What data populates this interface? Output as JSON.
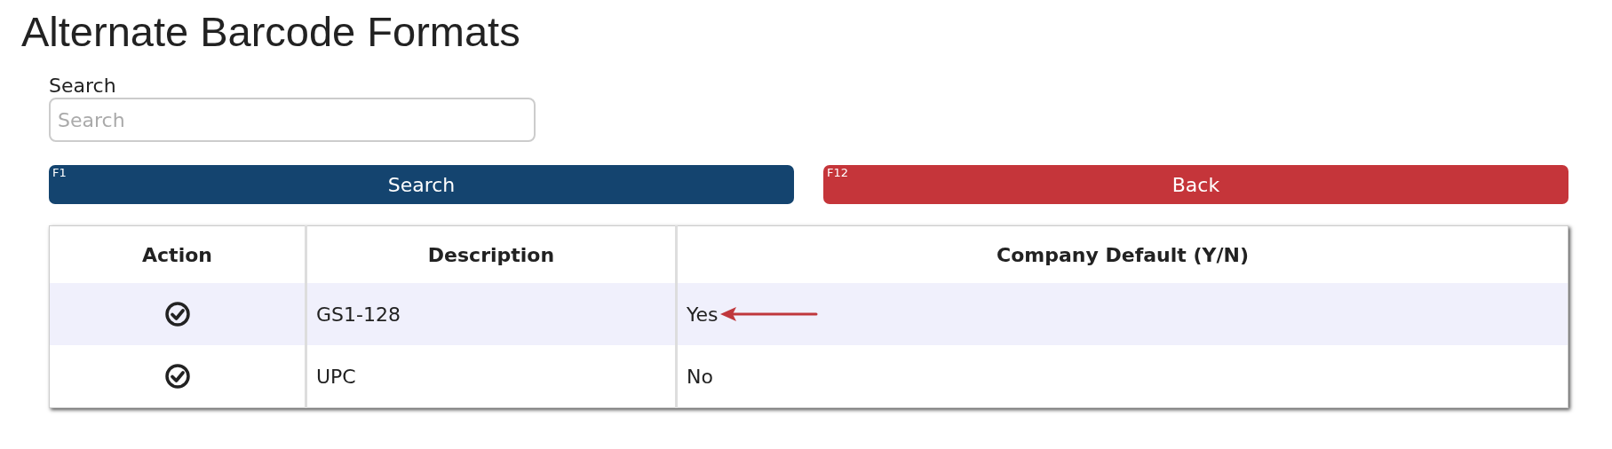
{
  "page_title": "Alternate Barcode Formats",
  "search": {
    "label": "Search",
    "placeholder": "Search"
  },
  "buttons": [
    {
      "kind": "primary",
      "shortcut": "F1",
      "label": "Search"
    },
    {
      "kind": "danger",
      "shortcut": "F12",
      "label": "Back"
    }
  ],
  "table": {
    "columns": [
      "Action",
      "Description",
      "Company Default (Y/N)"
    ],
    "rows": [
      {
        "description": "GS1-128",
        "company_default": "Yes",
        "highlighted": true,
        "arrow": true
      },
      {
        "description": "UPC",
        "company_default": "No",
        "highlighted": false,
        "arrow": false
      }
    ]
  }
}
